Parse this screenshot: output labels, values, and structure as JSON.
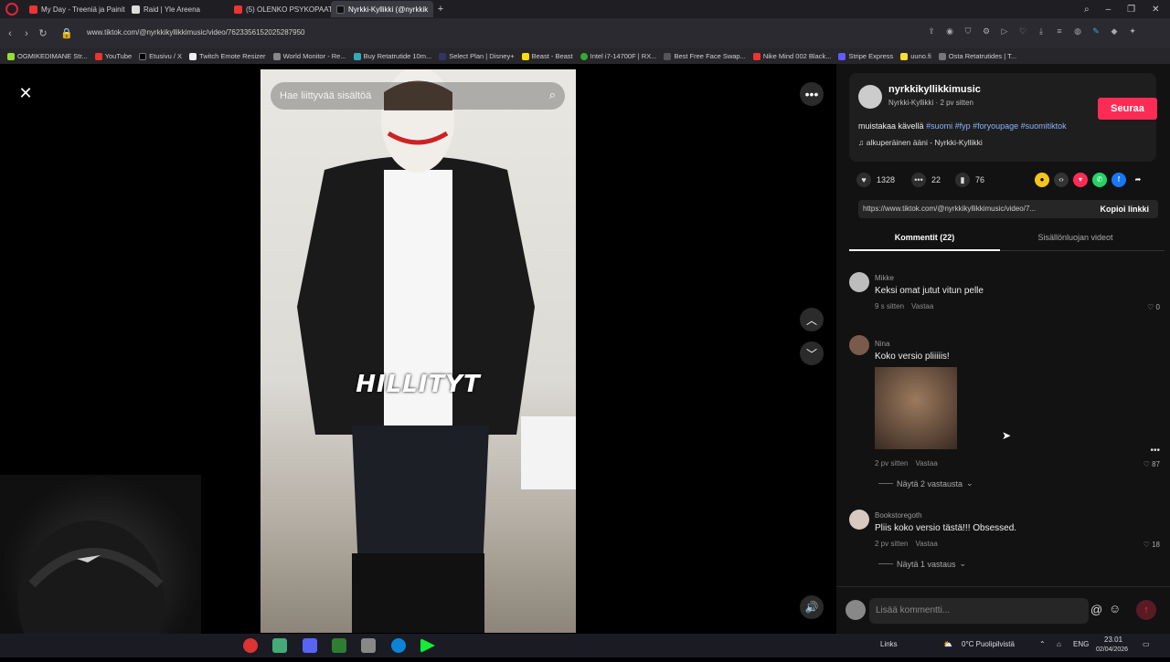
{
  "browser": {
    "tabs": [
      {
        "title": "My Day - Treeniä ja Painit",
        "color": "#e33"
      },
      {
        "title": "Raid | Yle Areena",
        "color": "#ddd"
      },
      {
        "title": "(5) OLENKO PSYKOPAATTI",
        "color": "#e33"
      },
      {
        "title": "Nyrkki-Kyllikki (@nyrkkik",
        "color": "#222"
      }
    ],
    "url": "www.tiktok.com/@nyrkkikyllikkimusic/video/7623356152025287950",
    "bookmarks": [
      "OGMIKEDIMANE Str...",
      "YouTube",
      "Etusivu / X",
      "Twitch Emote Resizer",
      "World Monitor - Re...",
      "Buy Retatrutide 10m...",
      "Select Plan | Disney+",
      "Beast - Beast",
      "Intel i7-14700F | RX...",
      "Best Free Face Swap...",
      "Nike Mind 002 Black...",
      "Stripe Express",
      "uuno.fi",
      "Osta Retatrutides | T..."
    ]
  },
  "video": {
    "search_placeholder": "Hae liittyvää sisältöä",
    "overlay_text": "HILLITYT"
  },
  "author": {
    "username": "nyrkkikyllikkimusic",
    "display_meta": "Nyrkki-Kyllikki · 2 pv sitten",
    "follow_label": "Seuraa",
    "caption": "muistakaa kävellä",
    "hashtags": "#suomi #fyp #foryoupage #suomitiktok",
    "sound": "alkuperäinen ääni - Nyrkki-Kyllikki"
  },
  "stats": {
    "likes": "1328",
    "comments": "22",
    "saves": "76"
  },
  "link": {
    "url": "https://www.tiktok.com/@nyrkkikyllikkimusic/video/7...",
    "copy_label": "Kopioi linkki"
  },
  "tabs": {
    "comments": "Kommentit (22)",
    "creator_videos": "Sisällönluojan videot"
  },
  "comments": [
    {
      "user": "Mikke",
      "text": "Keksi omat jutut vitun pelle",
      "time": "9 s sitten",
      "reply": "Vastaa",
      "likes": "0"
    },
    {
      "user": "Nina",
      "text": "Koko versio pliiiiis!",
      "time": "2 pv sitten",
      "reply": "Vastaa",
      "likes": "87",
      "more_replies": "Näytä 2 vastausta"
    },
    {
      "user": "Bookstoregoth",
      "text": "Pliis koko versio tästä!!! Obsessed.",
      "time": "2 pv sitten",
      "reply": "Vastaa",
      "likes": "18",
      "more_replies": "Näytä 1 vastaus"
    }
  ],
  "comment_input": {
    "placeholder": "Lisää kommentti..."
  },
  "taskbar": {
    "links_label": "Links",
    "weather": "0°C  Puolipilvistä",
    "lang": "ENG",
    "time": "23.01",
    "date": "02/04/2026"
  },
  "colors": {
    "accent": "#fe2c55",
    "hashtag": "#8ab4f8"
  }
}
